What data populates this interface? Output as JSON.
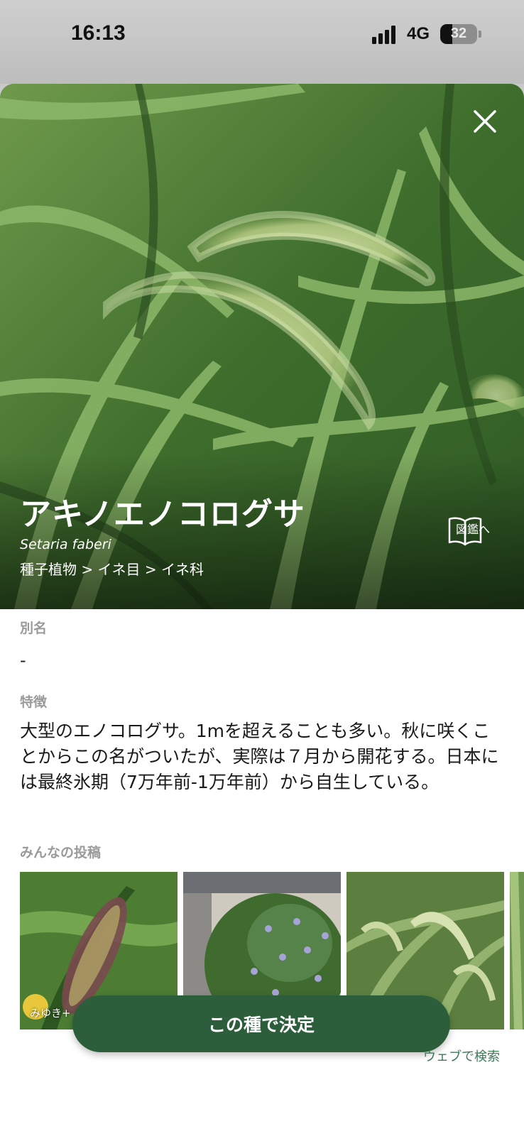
{
  "status_bar": {
    "time": "16:13",
    "network": "4G",
    "battery_level": "32",
    "battery_fraction": 0.32
  },
  "species": {
    "name": "アキノエノコログサ",
    "scientific_name": "Setaria faberi",
    "taxonomy": "種子植物 > イネ目 > イネ科",
    "encyclopedia_label": "図鑑へ"
  },
  "details": {
    "aliases_label": "別名",
    "aliases_value": "-",
    "features_label": "特徴",
    "features_text": "大型のエノコログサ。1mを超えることも多い。秋に咲くことからこの名がついたが、実際は７月から開花する。日本には最終氷期（7万年前-1万年前）から自生している。",
    "posts_label": "みんなの投稿",
    "posts": [
      {
        "user": "みゆき+"
      }
    ]
  },
  "actions": {
    "confirm_label": "この種で決定",
    "web_search_label": "ウェブで検索"
  },
  "colors": {
    "accent": "#2c5e3c",
    "link": "#3d7a56"
  },
  "icons": [
    "close-icon",
    "book-icon",
    "signal-icon",
    "battery-icon"
  ]
}
